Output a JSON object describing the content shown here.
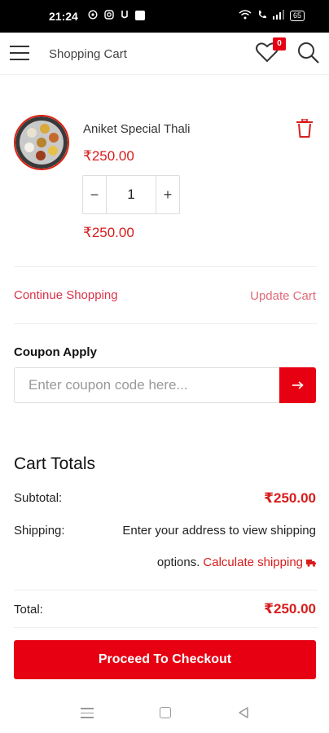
{
  "status_bar": {
    "time": "21:24",
    "left_icons": [
      "whatsapp-icon",
      "instagram-icon",
      "u-icon",
      "notification-square-icon"
    ],
    "battery": "65"
  },
  "header": {
    "title": "Shopping Cart",
    "wishlist_count": "0"
  },
  "cart_item": {
    "name": "Aniket Special Thali",
    "price": "₹250.00",
    "quantity": "1",
    "minus_label": "−",
    "plus_label": "+",
    "subtotal": "₹250.00"
  },
  "actions": {
    "continue_shopping": "Continue Shopping",
    "update_cart": "Update Cart"
  },
  "coupon": {
    "label": "Coupon Apply",
    "placeholder": "Enter coupon code here..."
  },
  "totals": {
    "title": "Cart Totals",
    "subtotal_label": "Subtotal:",
    "subtotal_value": "₹250.00",
    "shipping_label": "Shipping:",
    "shipping_text_1": "Enter your address to view shipping",
    "shipping_text_2": "options.",
    "calculate_shipping": "Calculate shipping",
    "total_label": "Total:",
    "total_value": "₹250.00"
  },
  "checkout": {
    "button_label": "Proceed To Checkout"
  },
  "colors": {
    "accent": "#e60012",
    "price": "#d81c1c"
  }
}
